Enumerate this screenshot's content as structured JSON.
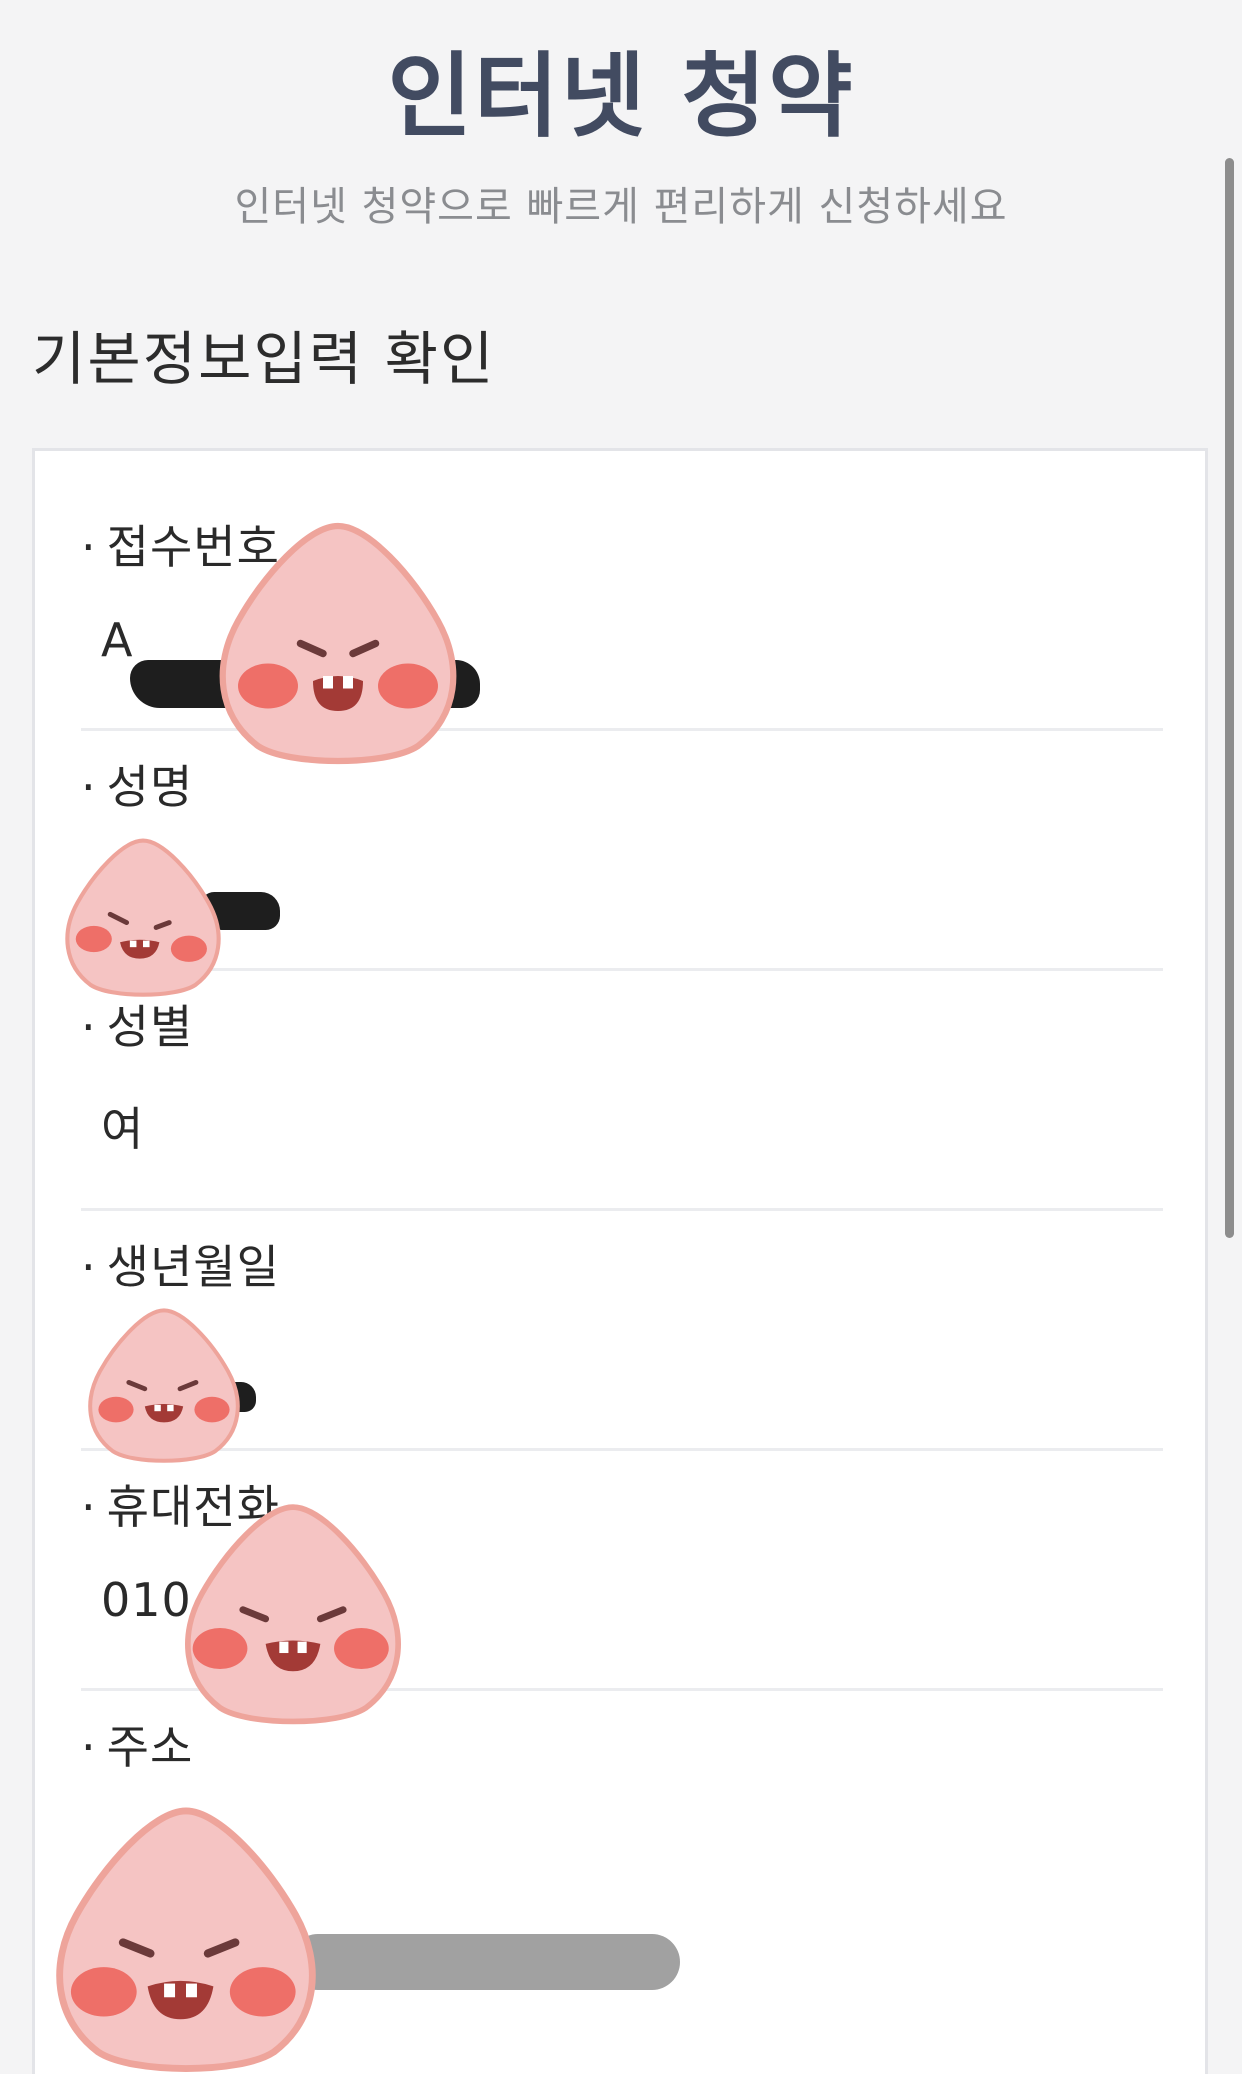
{
  "header": {
    "title": "인터넷 청약",
    "subtitle": "인터넷 청약으로 빠르게 편리하게 신청하세요"
  },
  "section": {
    "title": "기본정보입력 확인"
  },
  "fields": [
    {
      "label": "접수번호",
      "value": "A"
    },
    {
      "label": "성명",
      "value": ""
    },
    {
      "label": "성별",
      "value": "여"
    },
    {
      "label": "생년월일",
      "value": ""
    },
    {
      "label": "휴대전화",
      "value": "010"
    },
    {
      "label": "주소",
      "value": ""
    }
  ],
  "bullet": "·",
  "colors": {
    "title": "#424b61",
    "subtitle": "#8a8c90",
    "card_border": "#e3e4e8",
    "sticker_body": "#f5c4c3",
    "sticker_outline": "#eea49b",
    "sticker_cheek": "#ee6f68",
    "sticker_mouth": "#a33a36"
  },
  "icons": [
    "peach-sticker-icon",
    "redaction-scribble"
  ]
}
